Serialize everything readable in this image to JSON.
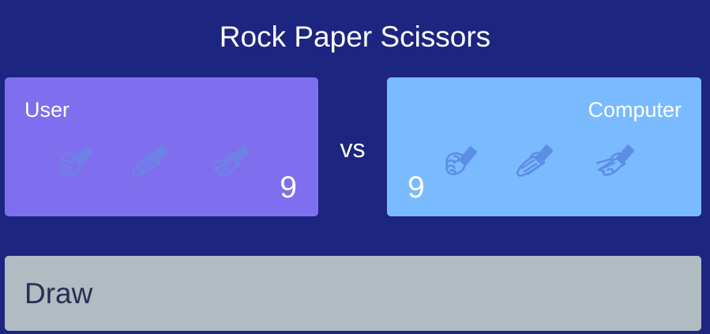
{
  "title": "Rock Paper Scissors",
  "vs_label": "vs",
  "user": {
    "name": "User",
    "score": "9",
    "choices": [
      "rock-hand-icon",
      "paper-hand-icon",
      "scissors-hand-icon"
    ]
  },
  "computer": {
    "name": "Computer",
    "score": "9",
    "choices": [
      "rock-hand-icon",
      "paper-hand-icon",
      "scissors-hand-icon"
    ]
  },
  "result": "Draw",
  "colors": {
    "background": "#1c2580",
    "user_panel": "#7f6fee",
    "computer_panel": "#7abaff",
    "result_bar": "#b1bbc2",
    "hand_icon_user": "#6e82e6",
    "hand_icon_computer": "#5c8ee6"
  }
}
